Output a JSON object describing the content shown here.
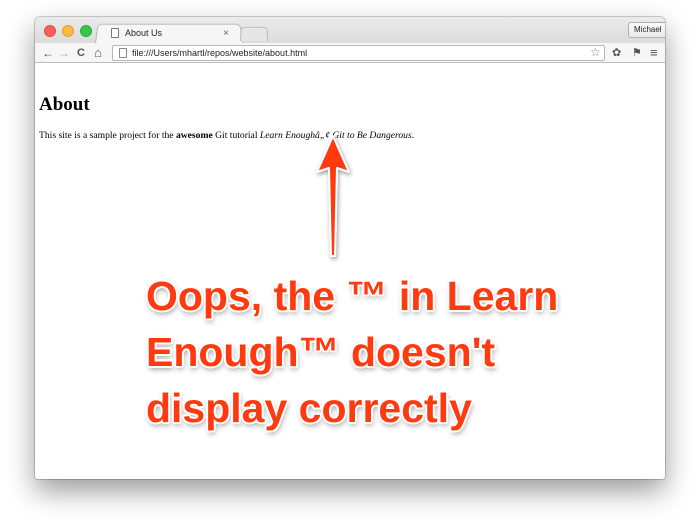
{
  "browser": {
    "tab_title": "About Us",
    "tab_close": "×",
    "profile_name": "Michael",
    "url": "file:///Users/mhartl/repos/website/about.html",
    "nav": {
      "back": "←",
      "forward": "→",
      "reload": "C",
      "home": "⌂"
    },
    "icons": {
      "star": "☆",
      "settings": "✿",
      "extension": "⚑",
      "menu": "≡"
    },
    "colors": {
      "close": "#fc605c",
      "minimize": "#fdbc40",
      "maximize": "#34c84a"
    }
  },
  "page": {
    "heading": "About",
    "paragraph": {
      "before": "This site is a sample project for the ",
      "bold": "awesome",
      "middle": " Git tutorial ",
      "italic": "Learn Enoughâ„¢ Git to Be Dangerous",
      "after": "."
    }
  },
  "annotation": {
    "lines": [
      "Oops, the ™ in Learn",
      "Enough™ doesn't",
      "display correctly"
    ],
    "color": "#ff3a10"
  }
}
